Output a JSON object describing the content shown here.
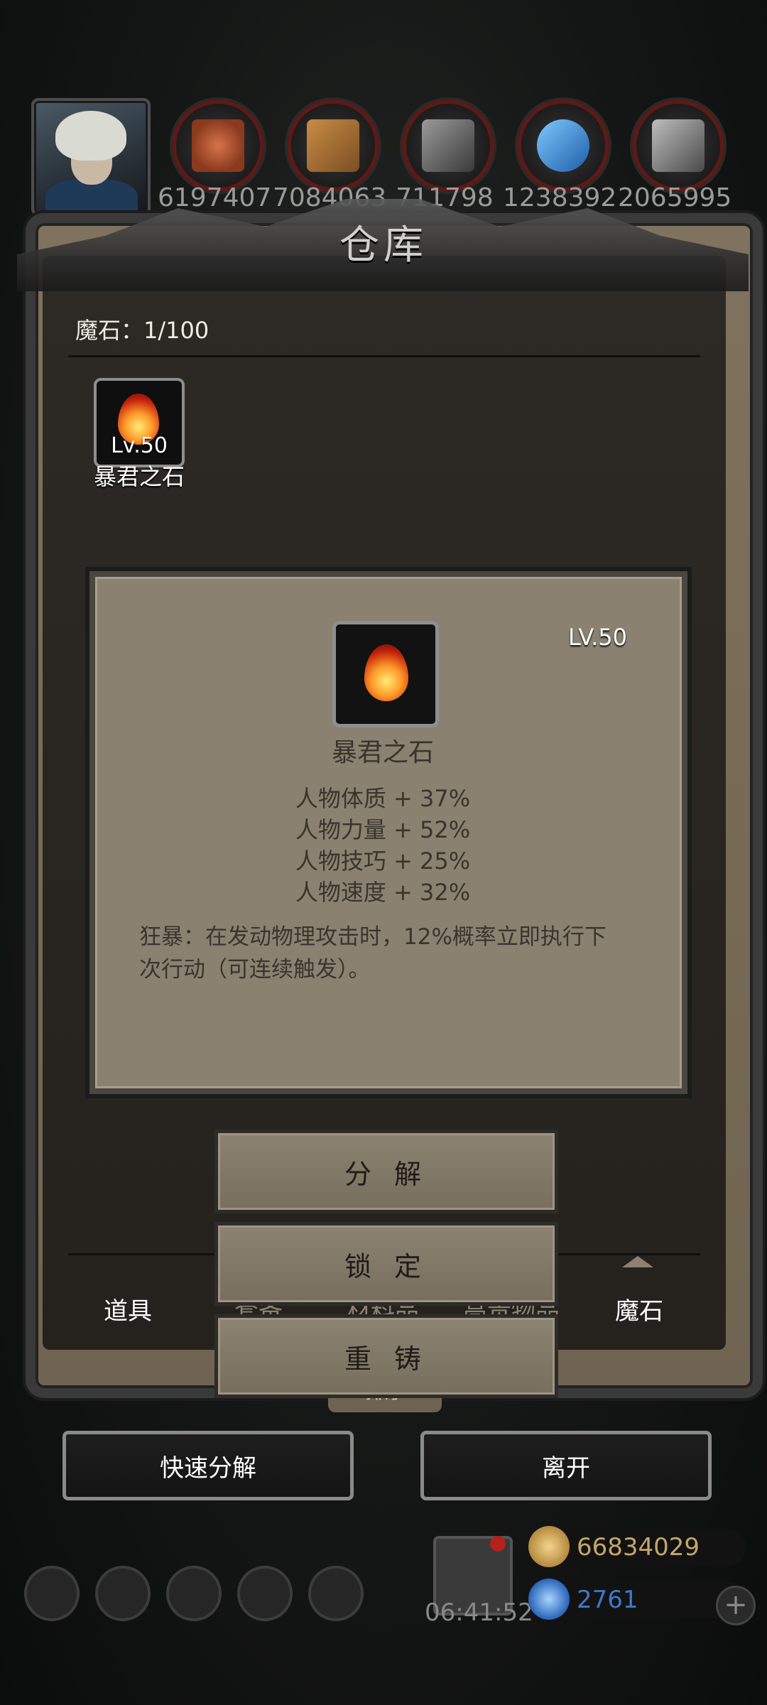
{
  "resources": {
    "values": [
      "6197407",
      "7084063",
      "711798",
      "1238392",
      "2065995"
    ],
    "icons": [
      "meat-icon",
      "wood-icon",
      "iron-icon",
      "crystal-icon",
      "stone-icon"
    ]
  },
  "window": {
    "title": "仓库"
  },
  "inventory": {
    "count_label": "魔石：1/100",
    "items": [
      {
        "name": "暴君之石",
        "level": "Lv.50"
      }
    ]
  },
  "detail": {
    "level": "LV.50",
    "name": "暴君之石",
    "stats": [
      "人物体质 + 37%",
      "人物力量 + 52%",
      "人物技巧 + 25%",
      "人物速度 + 32%"
    ],
    "description": "狂暴：在发动物理攻击时，12%概率立即执行下次行动（可连续触发）。"
  },
  "actions": {
    "decompose": "分 解",
    "lock": "锁 定",
    "reforge": "重 铸"
  },
  "tabs": {
    "items": "道具",
    "equipment": "套备",
    "materials": "材料品",
    "valuables": "高贵物品",
    "magic_stone": "魔石",
    "partial_bottom": "排序"
  },
  "footer": {
    "quick_decompose": "快速分解",
    "leave": "离开"
  },
  "bottom_bar": {
    "timer": "06:41:52",
    "gold": "66834029",
    "gems": "2761",
    "plus": "+"
  },
  "colors": {
    "gold": "#c4a66b",
    "gem": "#3e79c9",
    "accent_red": "#5a1b16"
  }
}
